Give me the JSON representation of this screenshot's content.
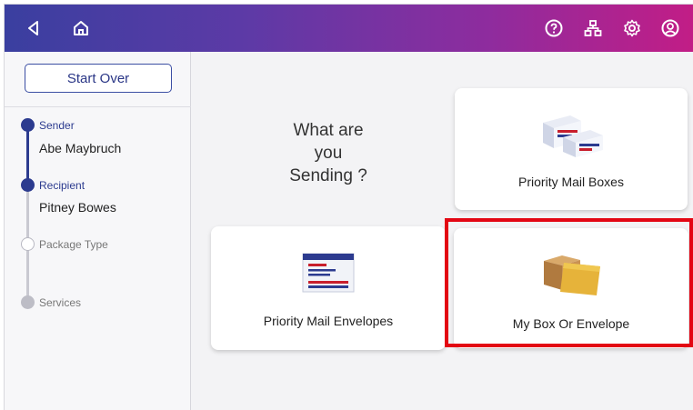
{
  "topbar": {
    "icons": [
      "back-icon",
      "home-icon",
      "help-icon",
      "network-icon",
      "settings-icon",
      "account-icon"
    ],
    "gradient_start": "#3a3fa0",
    "gradient_end": "#c21d86"
  },
  "sidebar": {
    "start_over_label": "Start Over",
    "steps": [
      {
        "label": "Sender",
        "value": "Abe Maybruch",
        "state": "done"
      },
      {
        "label": "Recipient",
        "value": "Pitney Bowes",
        "state": "done"
      },
      {
        "label": "Package Type",
        "value": "",
        "state": "current"
      },
      {
        "label": "Services",
        "value": "",
        "state": "pending"
      }
    ]
  },
  "main": {
    "question": "What are\nyou\nSending ?",
    "options": [
      {
        "label": "Priority Mail Boxes",
        "icon": "priority-boxes-icon"
      },
      {
        "label": "Priority Mail Envelopes",
        "icon": "priority-envelope-icon"
      },
      {
        "label": "My Box Or Envelope",
        "icon": "my-box-icon",
        "highlighted": true
      }
    ]
  },
  "colors": {
    "accent": "#2c3b8f",
    "highlight": "#e30613"
  }
}
